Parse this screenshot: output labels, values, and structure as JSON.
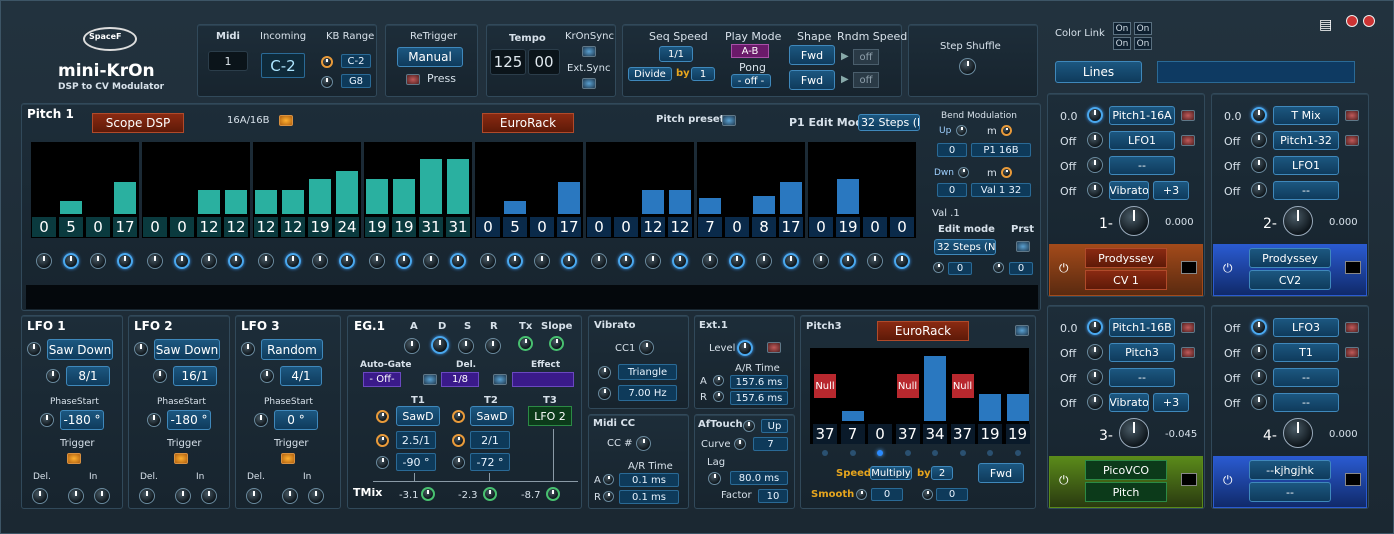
{
  "logo": {
    "brand": "SpaceF",
    "title": "mini-KrOn",
    "subtitle": "DSP to CV Modulator"
  },
  "midi": {
    "label": "Midi",
    "value": "1",
    "incoming_label": "Incoming",
    "incoming": "C-2",
    "kb_label": "KB Range",
    "kb_lo": "C-2",
    "kb_hi": "G8"
  },
  "retrigger": {
    "label": "ReTrigger",
    "mode": "Manual",
    "press": "Press"
  },
  "tempo": {
    "label": "Tempo",
    "a": "125",
    "b": "00",
    "kronsync": "KrOnSync",
    "extsync": "Ext.Sync"
  },
  "seq": {
    "speed_label": "Seq Speed",
    "speed": "1/1",
    "divide": "Divide",
    "by": "by",
    "by_val": "1",
    "play_label": "Play Mode",
    "play": "A-B",
    "pong_label": "Pong",
    "pong": "- off -",
    "shape_label": "Shape",
    "shape1": "Fwd",
    "shape2": "Fwd",
    "rndm_label": "Rndm Speed",
    "rndm1": "off",
    "rndm2": "off"
  },
  "shuffle": {
    "label": "Step Shuffle"
  },
  "colorlink": {
    "label": "Color Link",
    "b1": "On",
    "b2": "On",
    "b3": "On",
    "b4": "On",
    "lines": "Lines"
  },
  "pitch1": {
    "title": "Pitch 1",
    "scope": "Scope DSP",
    "mode": "16A/16B",
    "eurorack": "EuroRack",
    "presets": "Pitch presets",
    "edit_label": "P1 Edit Mode",
    "edit": "32 Steps (N",
    "values_a": [
      "0",
      "5",
      "0",
      "17",
      "0",
      "0",
      "12",
      "12",
      "12",
      "12",
      "19",
      "24",
      "19",
      "19",
      "31",
      "31"
    ],
    "values_b": [
      "0",
      "5",
      "0",
      "17",
      "0",
      "0",
      "12",
      "12",
      "7",
      "0",
      "8",
      "17",
      "0",
      "19",
      "0",
      "0"
    ]
  },
  "bend": {
    "label": "Bend Modulation",
    "up": "Up",
    "m": "m",
    "v1": "0",
    "t1": "P1 16B",
    "dwn": "Dwn",
    "v2": "0",
    "t2": "Val 1 32",
    "val": "Val .1",
    "edit_label": "Edit mode",
    "prst": "Prst",
    "edit": "32 Steps (N",
    "v3": "0",
    "v4": "0"
  },
  "lfo1": {
    "title": "LFO 1",
    "wave": "Saw Down",
    "rate": "8/1",
    "phase_label": "PhaseStart",
    "phase": "-180 °",
    "trigger": "Trigger",
    "del": "Del.",
    "in": "In"
  },
  "lfo2": {
    "title": "LFO 2",
    "wave": "Saw Down",
    "rate": "16/1",
    "phase_label": "PhaseStart",
    "phase": "-180 °",
    "trigger": "Trigger",
    "del": "Del.",
    "in": "In"
  },
  "lfo3": {
    "title": "LFO 3",
    "wave": "Random",
    "rate": "4/1",
    "phase_label": "PhaseStart",
    "phase": "0 °",
    "trigger": "Trigger",
    "del": "Del.",
    "in": "In"
  },
  "eg1": {
    "title": "EG.1",
    "a": "A",
    "d": "D",
    "s": "S",
    "r": "R",
    "tx": "Tx",
    "slope": "Slope",
    "autogate": "Auto-Gate",
    "autogate_val": "- Off-",
    "del": "Del.",
    "del_val": "1/8",
    "effect": "Effect",
    "t1": "T1",
    "t2": "T2",
    "t3": "T3",
    "t1w": "SawD",
    "t2w": "SawD",
    "t3w": "LFO 2",
    "t1r": "2.5/1",
    "t2r": "2/1",
    "t1p": "-90 °",
    "t2p": "-72 °",
    "tmix": "TMix",
    "m1": "-3.1",
    "m2": "-2.3",
    "m3": "-8.7"
  },
  "vibrato": {
    "title": "Vibrato",
    "cc": "CC1",
    "wave": "Triangle",
    "rate": "7.00 Hz"
  },
  "midicc": {
    "title": "Midi CC",
    "cc": "CC #",
    "ar": "A/R Time",
    "a": "A",
    "a_val": "0.1 ms",
    "r": "R",
    "r_val": "0.1 ms"
  },
  "ext1": {
    "title": "Ext.1",
    "level": "Level",
    "ar": "A/R Time",
    "a": "A",
    "a_val": "157.6 ms",
    "r": "R",
    "r_val": "157.6 ms"
  },
  "aftouch": {
    "title": "AfTouch",
    "dir": "Up",
    "curve": "Curve",
    "curve_val": "7",
    "lag": "Lag",
    "lag_val": "80.0 ms",
    "factor": "Factor",
    "factor_val": "10"
  },
  "pitch3": {
    "title": "Pitch3",
    "eurorack": "EuroRack",
    "null": "Null",
    "values": [
      "37",
      "7",
      "0",
      "37",
      "34",
      "37",
      "19",
      "19"
    ],
    "speed": "Speed",
    "multiply": "Multiply",
    "by": "by",
    "by_val": "2",
    "smooth": "Smooth",
    "s1": "0",
    "s2": "0",
    "fwd": "Fwd"
  },
  "out1": {
    "rows": [
      {
        "n": "0.0",
        "t": "Pitch1-16A"
      },
      {
        "n": "Off",
        "t": "LFO1"
      },
      {
        "n": "Off",
        "t": "--"
      },
      {
        "n": "Off",
        "t": "Vibrato",
        "v": "+3"
      }
    ],
    "idx": "1-",
    "val": "0.000",
    "dest": "Prodyssey",
    "cv": "CV 1"
  },
  "out2": {
    "rows": [
      {
        "n": "0.0",
        "t": "T Mix"
      },
      {
        "n": "Off",
        "t": "Pitch1-32"
      },
      {
        "n": "Off",
        "t": "LFO1"
      },
      {
        "n": "Off",
        "t": "--"
      }
    ],
    "idx": "2-",
    "val": "0.000",
    "dest": "Prodyssey",
    "cv": "CV2"
  },
  "out3": {
    "rows": [
      {
        "n": "0.0",
        "t": "Pitch1-16B"
      },
      {
        "n": "Off",
        "t": "Pitch3"
      },
      {
        "n": "Off",
        "t": "--"
      },
      {
        "n": "Off",
        "t": "Vibrato",
        "v": "+3"
      }
    ],
    "idx": "3-",
    "val": "-0.045",
    "dest": "PicoVCO",
    "cv": "Pitch"
  },
  "out4": {
    "rows": [
      {
        "n": "Off",
        "t": "LFO3"
      },
      {
        "n": "Off",
        "t": "T1"
      },
      {
        "n": "Off",
        "t": "--"
      },
      {
        "n": "Off",
        "t": "--"
      }
    ],
    "idx": "4-",
    "val": "0.000",
    "dest": "--kjhgjhk",
    "cv": "--"
  }
}
